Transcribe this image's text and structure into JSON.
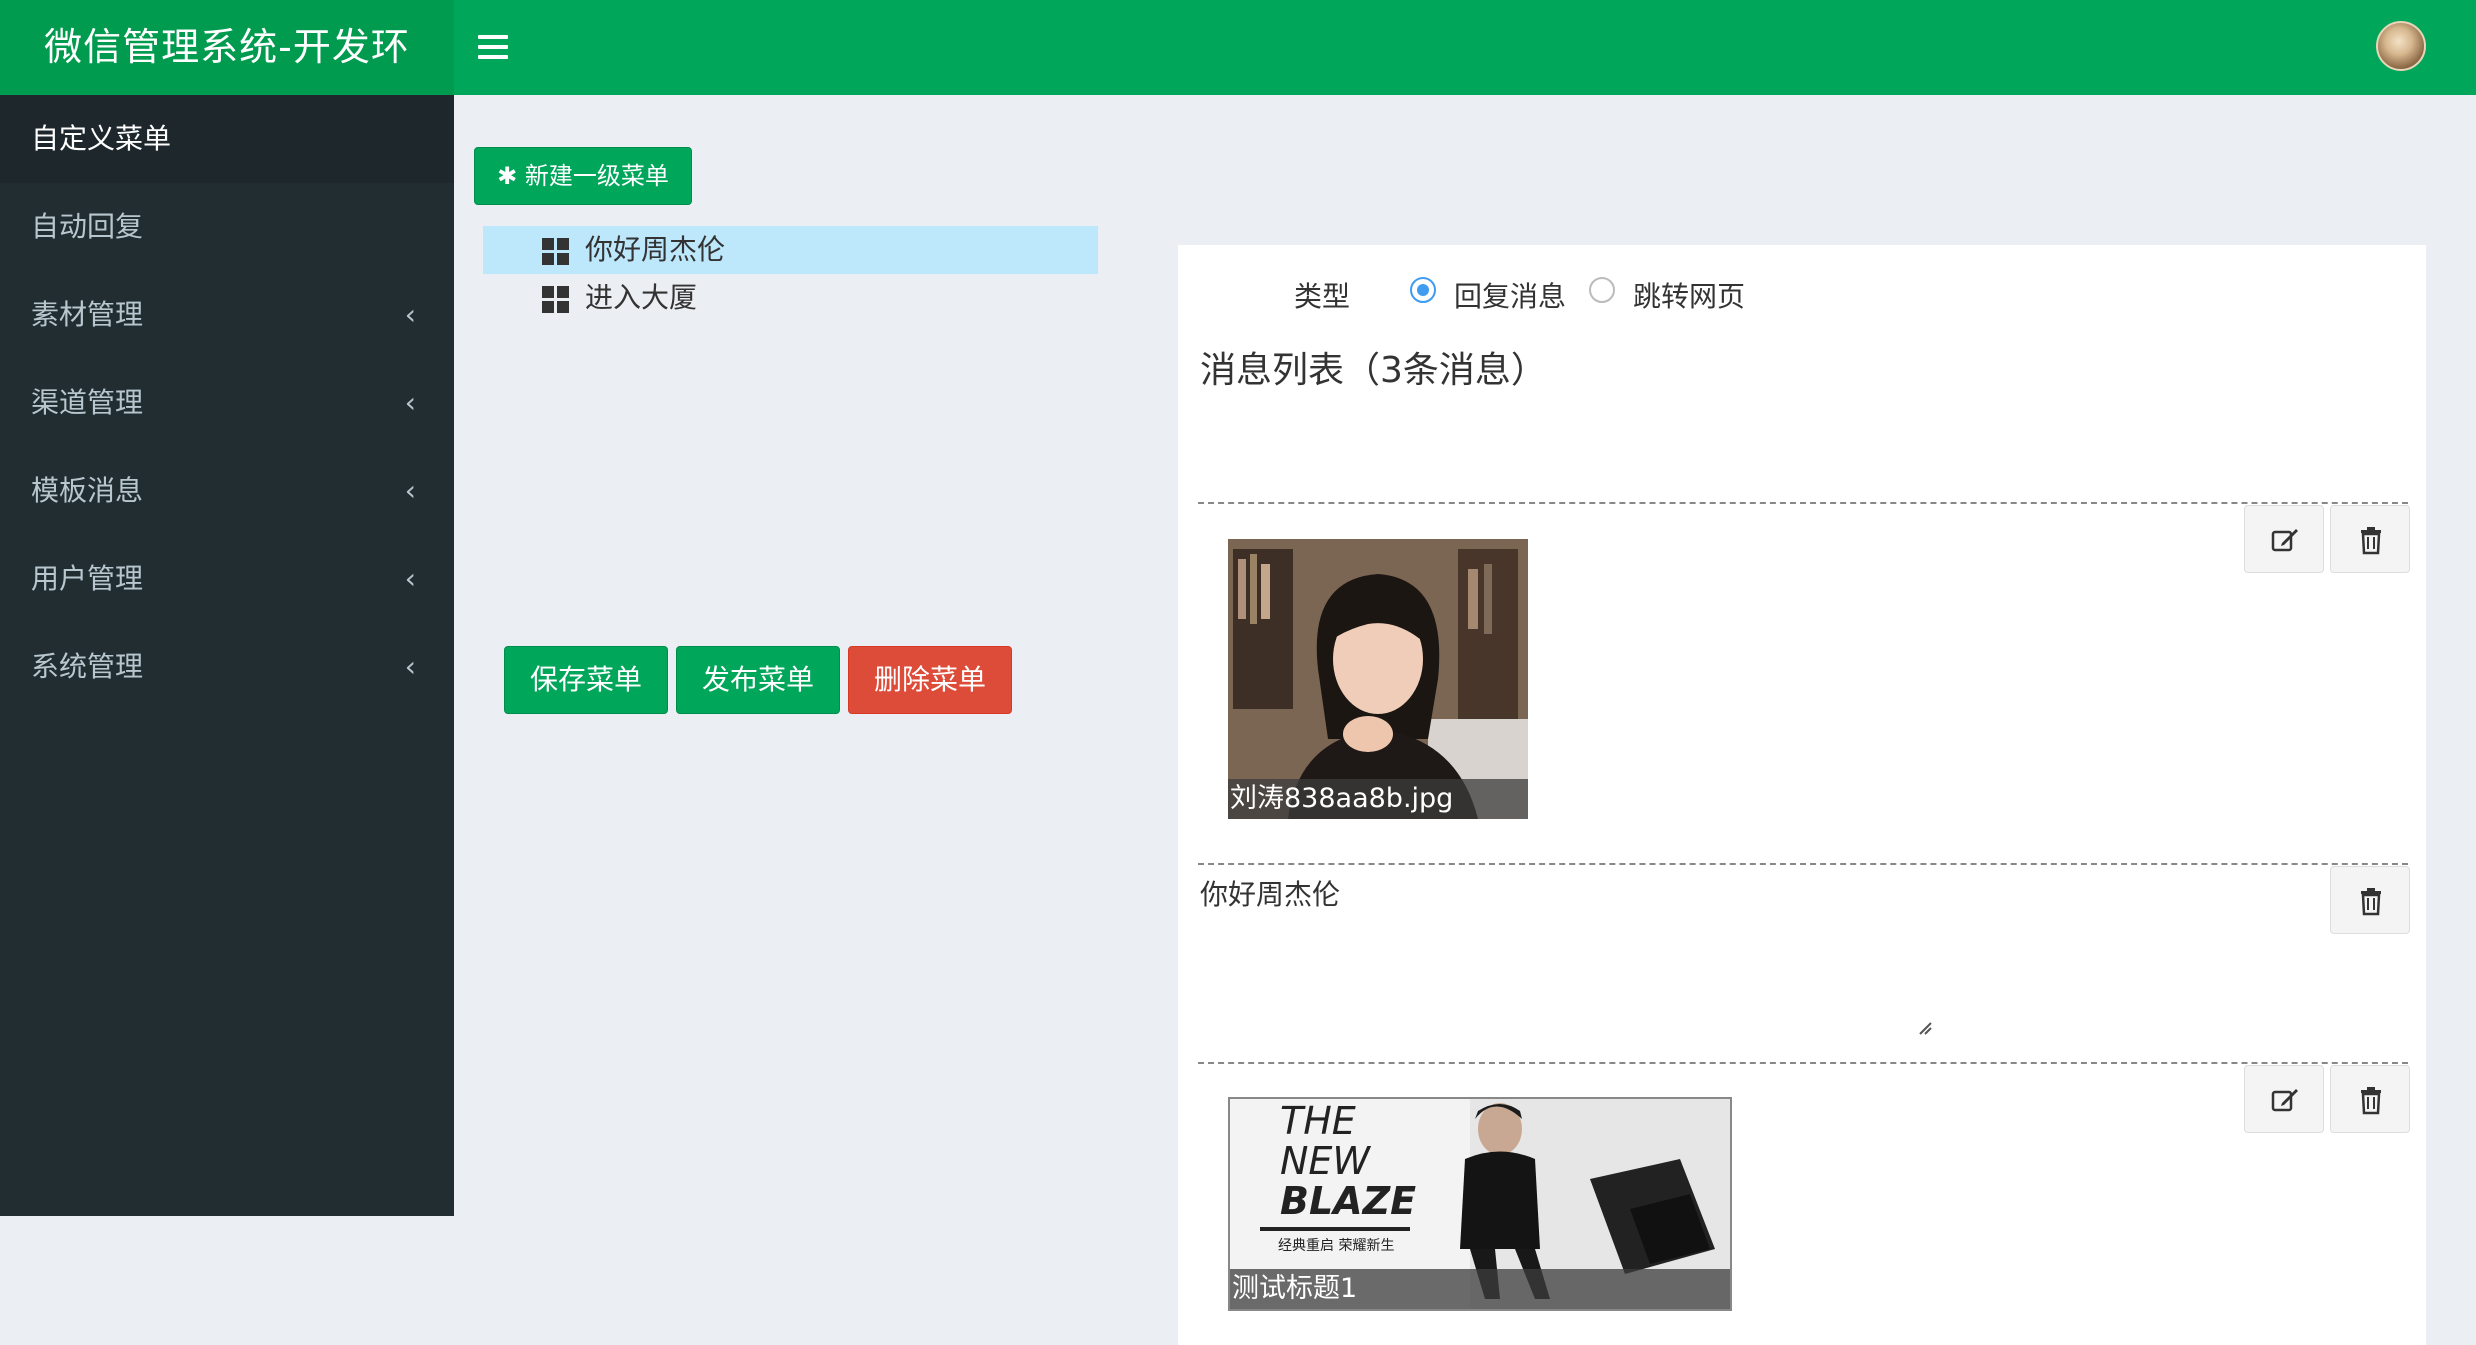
{
  "app": {
    "title": "微信管理系统-开发环"
  },
  "sidebar": {
    "items": [
      {
        "label": "自定义菜单",
        "active": true,
        "expandable": false
      },
      {
        "label": "自动回复",
        "active": false,
        "expandable": false
      },
      {
        "label": "素材管理",
        "active": false,
        "expandable": true
      },
      {
        "label": "渠道管理",
        "active": false,
        "expandable": true
      },
      {
        "label": "模板消息",
        "active": false,
        "expandable": true
      },
      {
        "label": "用户管理",
        "active": false,
        "expandable": true
      },
      {
        "label": "系统管理",
        "active": false,
        "expandable": true
      }
    ],
    "chevron": "‹"
  },
  "menu_editor": {
    "new_button": "新建一级菜单",
    "tree": [
      {
        "label": "你好周杰伦",
        "selected": true
      },
      {
        "label": "进入大厦",
        "selected": false
      }
    ],
    "save_button": "保存菜单",
    "publish_button": "发布菜单",
    "delete_button": "删除菜单"
  },
  "detail": {
    "type_label": "类型",
    "type_options": [
      {
        "label": "回复消息",
        "selected": true
      },
      {
        "label": "跳转网页",
        "selected": false
      }
    ],
    "list_title": "消息列表（3条消息）",
    "messages": [
      {
        "kind": "image",
        "caption": "刘涛838aa8b.jpg"
      },
      {
        "kind": "text",
        "text": "你好周杰伦"
      },
      {
        "kind": "news",
        "caption": "测试标题1",
        "poster_lines": [
          "THE",
          "NEW",
          "BLAZE"
        ],
        "poster_tagline": "经典重启 荣耀新生"
      }
    ]
  },
  "colors": {
    "brand": "#009b4e",
    "header": "#00a65a",
    "sidebar": "#222d32",
    "danger": "#dd4b39",
    "tree_selected": "#bde7fb"
  }
}
